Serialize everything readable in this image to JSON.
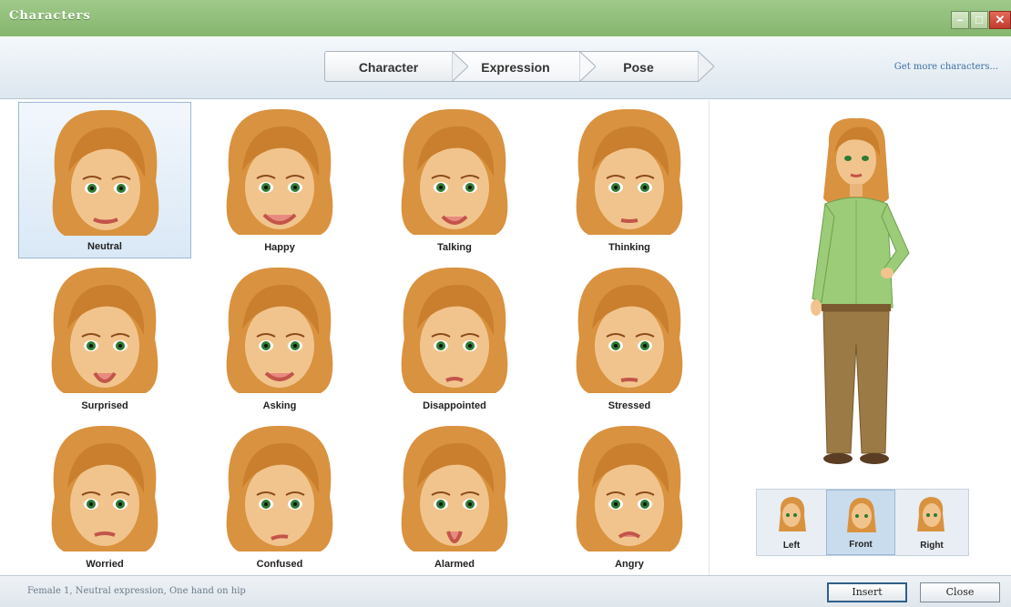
{
  "window": {
    "title": "Characters"
  },
  "tabs": [
    {
      "label": "Character"
    },
    {
      "label": "Expression"
    },
    {
      "label": "Pose"
    }
  ],
  "get_more_link": "Get more characters...",
  "expressions": [
    {
      "label": "Neutral",
      "selected": true
    },
    {
      "label": "Happy"
    },
    {
      "label": "Talking"
    },
    {
      "label": "Thinking"
    },
    {
      "label": "Surprised"
    },
    {
      "label": "Asking"
    },
    {
      "label": "Disappointed"
    },
    {
      "label": "Stressed"
    },
    {
      "label": "Worried"
    },
    {
      "label": "Confused"
    },
    {
      "label": "Alarmed"
    },
    {
      "label": "Angry"
    }
  ],
  "views": [
    {
      "label": "Left"
    },
    {
      "label": "Front",
      "active": true
    },
    {
      "label": "Right"
    }
  ],
  "status": "Female 1, Neutral expression, One hand on hip",
  "buttons": {
    "insert": "Insert",
    "close": "Close"
  },
  "colors": {
    "titlebar": "#8fbf78",
    "selected_cell": "#dae8f6",
    "link": "#3a6ea5",
    "hair": "#d9923f",
    "skin": "#f2c48d",
    "shirt": "#9ccc78",
    "pants": "#9b7a45"
  }
}
